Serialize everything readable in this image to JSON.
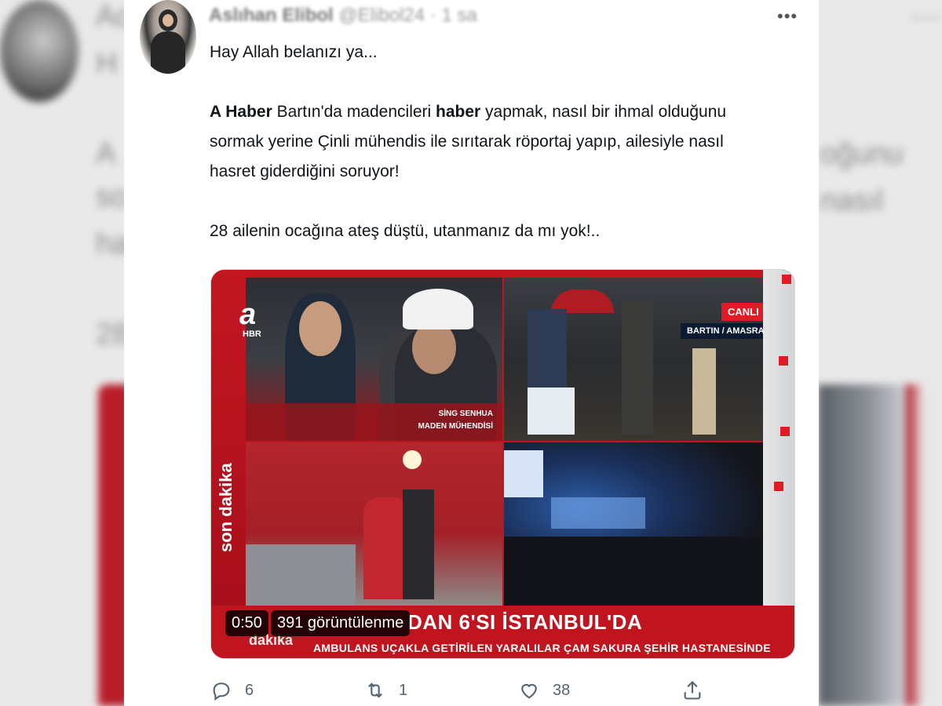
{
  "tweet": {
    "author_name": "Aslıhan Elibol",
    "author_handle": "@Elibol24",
    "time": "· 1 sa",
    "text_line1": "Hay Allah belanızı ya...",
    "text_p2_bold1": "A Haber",
    "text_p2_part1": " Bartın'da madencileri ",
    "text_p2_bold2": "haber",
    "text_p2_part2": " yapmak, nasıl bir ihmal olduğunu",
    "text_p2_line2": "sormak yerine Çinli mühendis ile sırıtarak röportaj yapıp, ailesiyle nasıl",
    "text_p2_line3": "hasret giderdiğini soruyor!",
    "text_p3": "28 ailenin ocağına ateş düştü, utanmanız da mı yok!.."
  },
  "media": {
    "logo": "a",
    "logo_sub": "HBR",
    "side_text": "son dakika",
    "lower_third_line1": "SİNG SENHUA",
    "lower_third_line2": "MADEN MÜHENDİSİ",
    "live_badge": "CANLI",
    "location": "BARTIN / AMASRA",
    "headline": "DAN 6'SI İSTANBUL'DA",
    "subline": "AMBULANS UÇAKLA GETİRİLEN YARALILAR ÇAM SAKURA ŞEHİR HASTANESİNDE",
    "dakika_small": "dakika",
    "duration": "0:50",
    "views": "391 görüntülenme"
  },
  "actions": {
    "reply_count": "6",
    "retweet_count": "1",
    "like_count": "38",
    "share_label": ""
  },
  "icons": {
    "more": "more-horizontal-icon",
    "reply": "reply-icon",
    "retweet": "retweet-icon",
    "like": "heart-icon",
    "share": "share-icon"
  },
  "colors": {
    "accent_red": "#c0141f",
    "text_primary": "#0f1419",
    "text_secondary": "#536471"
  }
}
